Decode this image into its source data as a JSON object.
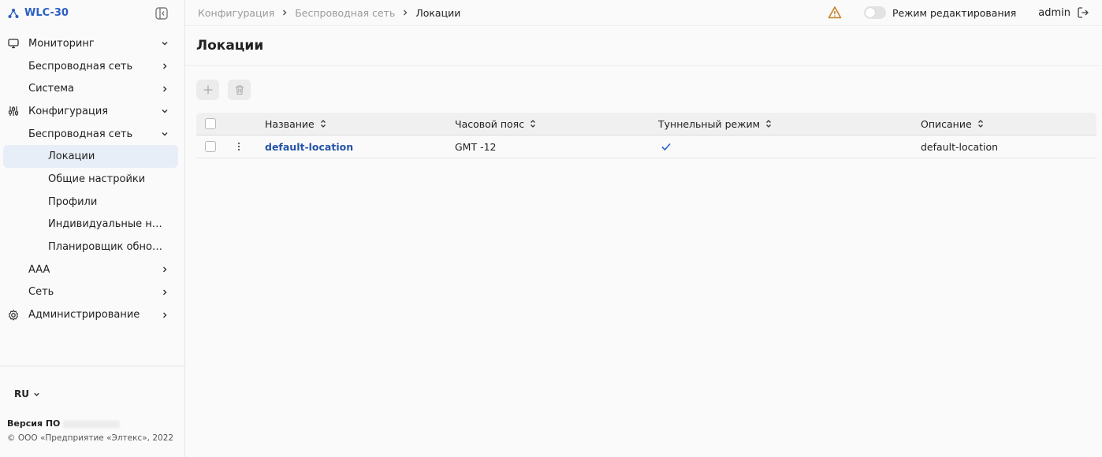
{
  "app": {
    "name": "WLC-30"
  },
  "sidebar": {
    "items": [
      {
        "label": "Мониторинг",
        "icon": "monitor-icon",
        "level": 0,
        "chevron": "down"
      },
      {
        "label": "Беспроводная сеть",
        "level": 1,
        "chevron": "right"
      },
      {
        "label": "Система",
        "level": 1,
        "chevron": "right"
      },
      {
        "label": "Конфигурация",
        "icon": "sliders-icon",
        "level": 0,
        "chevron": "down"
      },
      {
        "label": "Беспроводная сеть",
        "level": 1,
        "chevron": "down"
      },
      {
        "label": "Локации",
        "level": 2,
        "active": true
      },
      {
        "label": "Общие настройки",
        "level": 2
      },
      {
        "label": "Профили",
        "level": 2
      },
      {
        "label": "Индивидуальные настро…",
        "level": 2
      },
      {
        "label": "Планировщик обновлен…",
        "level": 2
      },
      {
        "label": "AAA",
        "level": 1,
        "chevron": "right"
      },
      {
        "label": "Сеть",
        "level": 1,
        "chevron": "right"
      },
      {
        "label": "Администрирование",
        "icon": "gear-icon",
        "level": 0,
        "chevron": "right"
      }
    ],
    "footer": {
      "lang": "RU",
      "version_label": "Версия ПО",
      "copyright": "© ООО «Предприятие «Элтекс», 2022"
    }
  },
  "header": {
    "breadcrumb": [
      "Конфигурация",
      "Беспроводная сеть",
      "Локации"
    ],
    "edit_mode_label": "Режим редактирования",
    "user": "admin",
    "warning_color": "#c9822b",
    "accent": "#2b5fc2"
  },
  "main": {
    "title": "Локации",
    "table": {
      "columns": [
        "Название",
        "Часовой пояс",
        "Туннельный режим",
        "Описание"
      ],
      "rows": [
        {
          "name": "default-location",
          "timezone": "GMT -12",
          "tunnel": true,
          "description": "default-location"
        }
      ]
    }
  }
}
